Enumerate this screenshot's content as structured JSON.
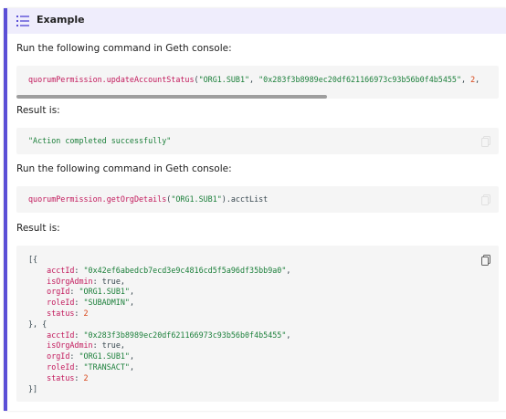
{
  "admonition": {
    "title": "Example",
    "icon": "list-icon",
    "accent_color": "#5b4fd6"
  },
  "paragraphs": {
    "run1": "Run the following command in Geth console:",
    "result1": "Result is:",
    "run2": "Run the following command in Geth console:",
    "result2": "Result is:"
  },
  "code1": {
    "fn": "quorumPermission.updateAccountStatus",
    "open": "(",
    "arg1": "\"ORG1.SUB1\"",
    "sep1": ", ",
    "arg2": "\"0x283f3b8989ec20df621166973c93b56b0f4b5455\"",
    "sep2": ", ",
    "arg3": "2",
    "tail": ","
  },
  "code2": {
    "text": "\"Action completed successfully\""
  },
  "code3": {
    "fn": "quorumPermission.getOrgDetails",
    "open": "(",
    "arg1": "\"ORG1.SUB1\"",
    "close": ").acctList"
  },
  "code4": {
    "lines": [
      {
        "plain": "[{"
      },
      {
        "key": "    acctId",
        "colon": ": ",
        "value": "\"0x42ef6abedcb7ecd3e9c4816cd5f5a96df35bb9a0\"",
        "vtype": "str",
        "end": ","
      },
      {
        "key": "    isOrgAdmin",
        "colon": ": ",
        "value": "true",
        "vtype": "kw",
        "end": ","
      },
      {
        "key": "    orgId",
        "colon": ": ",
        "value": "\"ORG1.SUB1\"",
        "vtype": "str",
        "end": ","
      },
      {
        "key": "    roleId",
        "colon": ": ",
        "value": "\"SUBADMIN\"",
        "vtype": "str",
        "end": ","
      },
      {
        "key": "    status",
        "colon": ": ",
        "value": "2",
        "vtype": "num",
        "end": ""
      },
      {
        "plain": "}, {"
      },
      {
        "key": "    acctId",
        "colon": ": ",
        "value": "\"0x283f3b8989ec20df621166973c93b56b0f4b5455\"",
        "vtype": "str",
        "end": ","
      },
      {
        "key": "    isOrgAdmin",
        "colon": ": ",
        "value": "true",
        "vtype": "kw",
        "end": ","
      },
      {
        "key": "    orgId",
        "colon": ": ",
        "value": "\"ORG1.SUB1\"",
        "vtype": "str",
        "end": ","
      },
      {
        "key": "    roleId",
        "colon": ": ",
        "value": "\"TRANSACT\"",
        "vtype": "str",
        "end": ","
      },
      {
        "key": "    status",
        "colon": ": ",
        "value": "2",
        "vtype": "num",
        "end": ""
      },
      {
        "plain": "}]"
      }
    ]
  },
  "copy_icon": "copy-icon"
}
